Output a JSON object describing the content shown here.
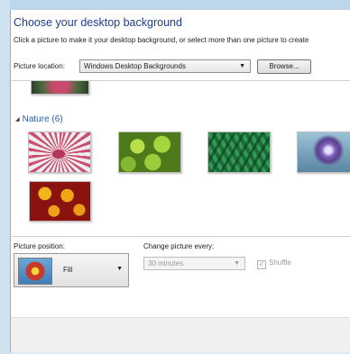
{
  "header": {
    "title": "Choose your desktop background",
    "subtitle": "Click a picture to make it your desktop background, or select more than one picture to create"
  },
  "location": {
    "label": "Picture location:",
    "selected": "Windows Desktop Backgrounds",
    "browse_label": "Browse..."
  },
  "gallery": {
    "group_label": "Nature (6)"
  },
  "position": {
    "label": "Picture position:",
    "selected": "Fill"
  },
  "interval": {
    "label": "Change picture every:",
    "selected": "30 minutes"
  },
  "shuffle": {
    "label": "Shuffle",
    "checked": true,
    "enabled": false
  },
  "colors": {
    "title": "#1e3c8a",
    "group_header": "#2f5ba7",
    "frame": "#dce9f2"
  }
}
